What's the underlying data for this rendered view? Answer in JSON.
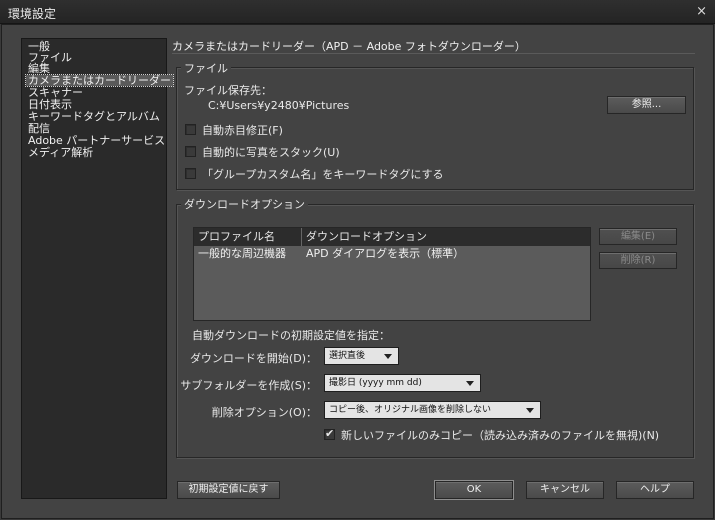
{
  "window": {
    "title": "環境設定",
    "close": "×"
  },
  "sidebar": {
    "items": [
      {
        "label": "一般"
      },
      {
        "label": "ファイル"
      },
      {
        "label": "編集"
      },
      {
        "label": "カメラまたはカードリーダー",
        "selected": true
      },
      {
        "label": "スキャナー"
      },
      {
        "label": "日付表示"
      },
      {
        "label": "キーワードタグとアルバム"
      },
      {
        "label": "配信"
      },
      {
        "label": "Adobe パートナーサービス"
      },
      {
        "label": "メディア解析"
      }
    ]
  },
  "page": {
    "title": "カメラまたはカードリーダー（APD － Adobe フォトダウンローダー）"
  },
  "files": {
    "group_label": "ファイル",
    "save_location_label": "ファイル保存先：",
    "save_path": "C:¥Users¥y2480¥Pictures",
    "browse_button": "参照...",
    "options": [
      {
        "label": "自動赤目修正(F)",
        "checked": false
      },
      {
        "label": "自動的に写真をスタック(U)",
        "checked": false
      },
      {
        "label": "「グループカスタム名」をキーワードタグにする",
        "checked": false
      }
    ]
  },
  "download": {
    "group_label": "ダウンロードオプション",
    "table": {
      "headers": [
        "プロファイル名",
        "ダウンロードオプション"
      ],
      "rows": [
        [
          "一般的な周辺機器",
          "APD ダイアログを表示（標準）"
        ]
      ]
    },
    "edit_button": "編集(E)",
    "delete_button": "削除(R)",
    "defaults_label": "自動ダウンロードの初期設定値を指定：",
    "start_label": "ダウンロードを開始(D)：",
    "start_value": "選択直後",
    "subfolder_label": "サブフォルダーを作成(S)：",
    "subfolder_value": "撮影日 (yyyy mm dd)",
    "delete_opt_label": "削除オプション(O)：",
    "delete_opt_value": "コピー後、オリジナル画像を削除しない",
    "copy_new_label": "新しいファイルのみコピー（読み込み済みのファイルを無視)(N)",
    "copy_new_checked": true
  },
  "footer": {
    "reset": "初期設定値に戻す",
    "ok": "OK",
    "cancel": "キャンセル",
    "help": "ヘルプ"
  }
}
